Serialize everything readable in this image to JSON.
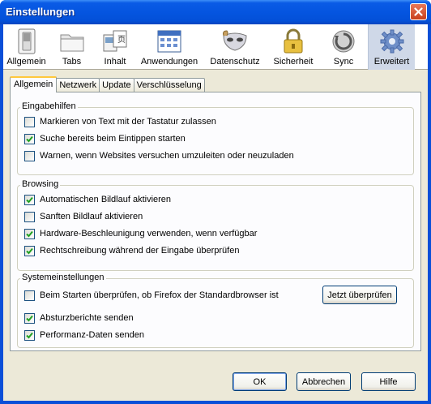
{
  "window": {
    "title": "Einstellungen"
  },
  "panes": [
    {
      "label": "Allgemein",
      "icon": "switch-icon",
      "selected": false
    },
    {
      "label": "Tabs",
      "icon": "tabs-folder-icon",
      "selected": false
    },
    {
      "label": "Inhalt",
      "icon": "content-page-icon",
      "selected": false
    },
    {
      "label": "Anwendungen",
      "icon": "applications-calendar-icon",
      "selected": false
    },
    {
      "label": "Datenschutz",
      "icon": "privacy-mask-icon",
      "selected": false
    },
    {
      "label": "Sicherheit",
      "icon": "padlock-icon",
      "selected": false
    },
    {
      "label": "Sync",
      "icon": "sync-icon",
      "selected": false
    },
    {
      "label": "Erweitert",
      "icon": "gear-icon",
      "selected": true
    }
  ],
  "tabs": [
    {
      "label": "Allgemein",
      "active": true
    },
    {
      "label": "Netzwerk",
      "active": false
    },
    {
      "label": "Update",
      "active": false
    },
    {
      "label": "Verschlüsselung",
      "active": false
    }
  ],
  "groups": {
    "accessibility": {
      "title": "Eingabehilfen",
      "options": [
        {
          "label": "Markieren von Text mit der Tastatur zulassen",
          "checked": false
        },
        {
          "label": "Suche bereits beim Eintippen starten",
          "checked": true
        },
        {
          "label": "Warnen, wenn Websites versuchen umzuleiten oder neuzuladen",
          "checked": false
        }
      ]
    },
    "browsing": {
      "title": "Browsing",
      "options": [
        {
          "label": "Automatischen Bildlauf aktivieren",
          "checked": true
        },
        {
          "label": "Sanften Bildlauf aktivieren",
          "checked": false
        },
        {
          "label": "Hardware-Beschleunigung verwenden, wenn verfügbar",
          "checked": true
        },
        {
          "label": "Rechtschreibung während der Eingabe überprüfen",
          "checked": true
        }
      ]
    },
    "system": {
      "title": "Systemeinstellungen",
      "options": [
        {
          "label": "Beim Starten überprüfen, ob Firefox der Standardbrowser ist",
          "checked": false
        },
        {
          "label": "Absturzberichte senden",
          "checked": true
        },
        {
          "label": "Performanz-Daten senden",
          "checked": true
        }
      ],
      "check_now_label": "Jetzt überprüfen"
    }
  },
  "buttons": {
    "ok": "OK",
    "cancel": "Abbrechen",
    "help": "Hilfe"
  }
}
